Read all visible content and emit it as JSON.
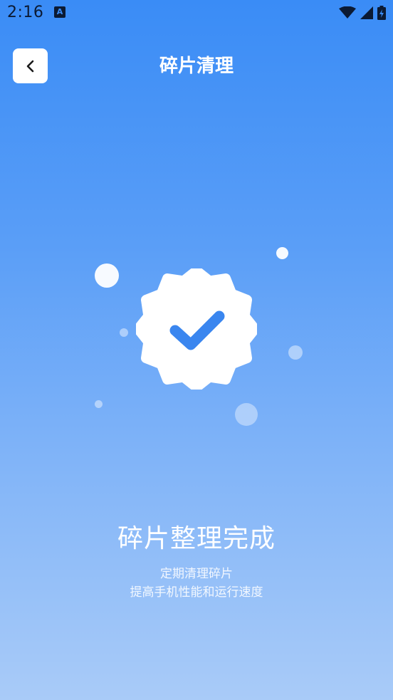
{
  "status_bar": {
    "time": "2:16",
    "notification_icon_letter": "A",
    "icons": [
      "wifi-icon",
      "signal-icon",
      "battery-charging-icon"
    ]
  },
  "header": {
    "back_icon": "chevron-left-icon",
    "title": "碎片清理"
  },
  "illustration": {
    "badge_icon": "verified-badge-icon",
    "check_icon": "checkmark-icon",
    "badge_color": "#ffffff",
    "check_color": "#3a86ef"
  },
  "result": {
    "title": "碎片整理完成",
    "subtitle_line1": "定期清理碎片",
    "subtitle_line2": "提高手机性能和运行速度"
  },
  "colors": {
    "background_top": "#3a8cf6",
    "background_bottom": "#a9cbf8",
    "status_text": "#0b1a33"
  }
}
